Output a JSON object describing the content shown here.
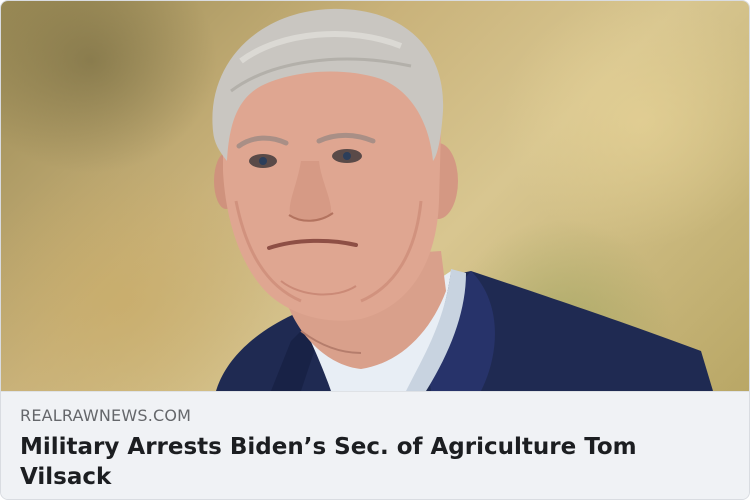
{
  "link_preview": {
    "image_alt": "Portrait of an older man with grey hair in a navy suit against a blurred autumn background",
    "source": "REALRAWNEWS.COM",
    "headline": "Military Arrests Biden’s Sec. of Agriculture Tom Vilsack"
  },
  "colors": {
    "meta_background": "#f0f2f5",
    "source_text": "#65676b",
    "headline_text": "#1c1e21",
    "suit": "#1f2a52"
  }
}
